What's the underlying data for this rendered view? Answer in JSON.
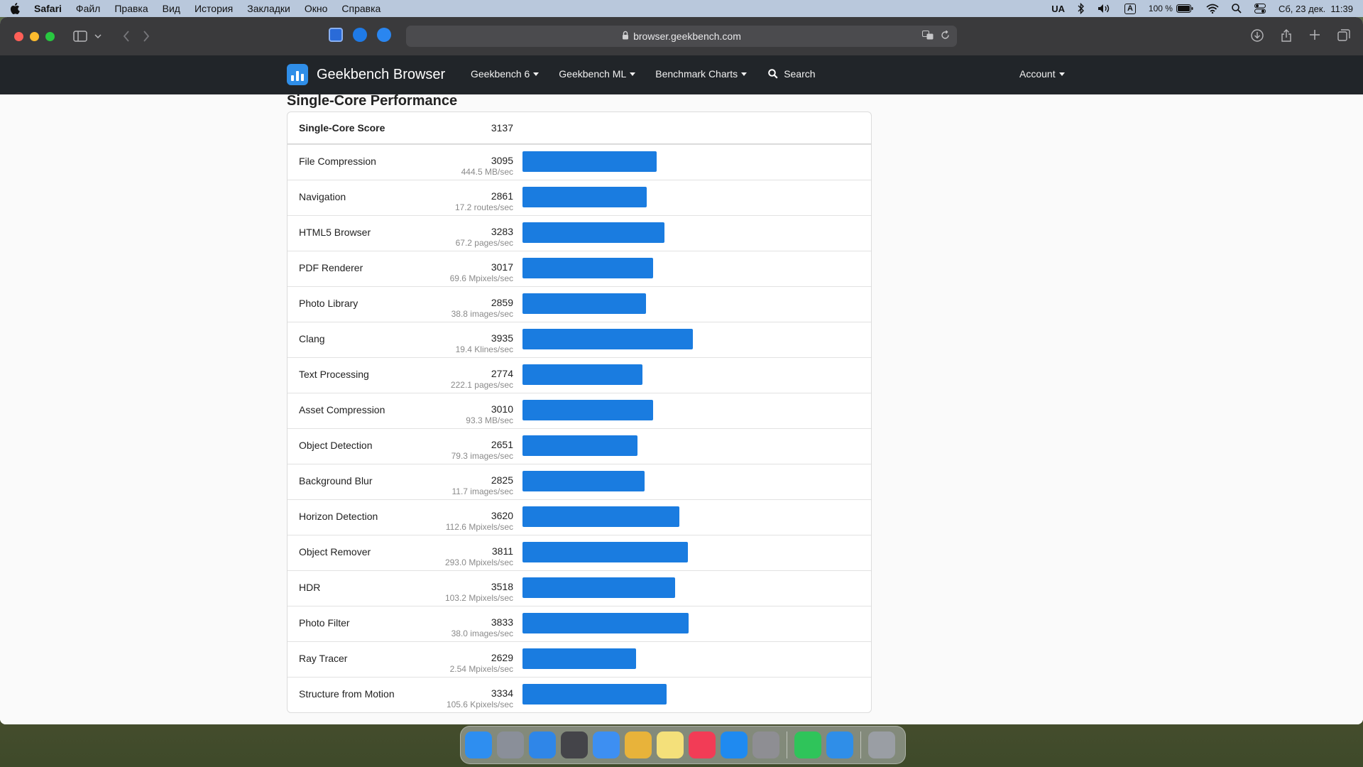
{
  "menubar": {
    "app": "Safari",
    "items": [
      "Файл",
      "Правка",
      "Вид",
      "История",
      "Закладки",
      "Окно",
      "Справка"
    ],
    "input_source": "UA",
    "input_badge": "A",
    "battery": "100 %",
    "datetime": "Сб, 23 дек.  11:39"
  },
  "browser": {
    "url": "browser.geekbench.com"
  },
  "site": {
    "brand": "Geekbench Browser",
    "nav": [
      {
        "label": "Geekbench 6"
      },
      {
        "label": "Geekbench ML"
      },
      {
        "label": "Benchmark Charts"
      }
    ],
    "search_label": "Search",
    "account_label": "Account"
  },
  "section_title": "Single-Core Performance",
  "summary": {
    "label": "Single-Core Score",
    "score": "3137"
  },
  "chart_data": {
    "type": "bar",
    "title": "Single-Core Performance",
    "orientation": "horizontal",
    "categories": [
      "File Compression",
      "Navigation",
      "HTML5 Browser",
      "PDF Renderer",
      "Photo Library",
      "Clang",
      "Text Processing",
      "Asset Compression",
      "Object Detection",
      "Background Blur",
      "Horizon Detection",
      "Object Remover",
      "HDR",
      "Photo Filter",
      "Ray Tracer",
      "Structure from Motion"
    ],
    "values": [
      3095,
      2861,
      3283,
      3017,
      2859,
      3935,
      2774,
      3010,
      2651,
      2825,
      3620,
      3811,
      3518,
      3833,
      2629,
      3334
    ],
    "rates": [
      "444.5 MB/sec",
      "17.2 routes/sec",
      "67.2 pages/sec",
      "69.6 Mpixels/sec",
      "38.8 images/sec",
      "19.4 Klines/sec",
      "222.1 pages/sec",
      "93.3 MB/sec",
      "79.3 images/sec",
      "11.7 images/sec",
      "112.6 Mpixels/sec",
      "293.0 Mpixels/sec",
      "103.2 Mpixels/sec",
      "38.0 images/sec",
      "2.54 Mpixels/sec",
      "105.6 Kpixels/sec"
    ],
    "xlim": [
      0,
      50000
    ],
    "grid": false,
    "bar_color": "#1a7ce0"
  },
  "dock": {
    "apps": [
      {
        "name": "finder",
        "color": "#2e8ef0"
      },
      {
        "name": "launchpad",
        "color": "#8a8f99"
      },
      {
        "name": "safari",
        "color": "#2f86e8"
      },
      {
        "name": "camera",
        "color": "#444449"
      },
      {
        "name": "mail",
        "color": "#3d8ff2"
      },
      {
        "name": "photos",
        "color": "#e8b33a"
      },
      {
        "name": "notes",
        "color": "#f4e07a"
      },
      {
        "name": "music",
        "color": "#f23c56"
      },
      {
        "name": "app-store",
        "color": "#1f8af0"
      },
      {
        "name": "system-settings",
        "color": "#8e8e93"
      },
      {
        "name": "whatsapp",
        "color": "#2fc45a"
      },
      {
        "name": "geekbench",
        "color": "#2f8ee8"
      },
      {
        "name": "trash",
        "color": "#9a9ea4"
      }
    ]
  }
}
